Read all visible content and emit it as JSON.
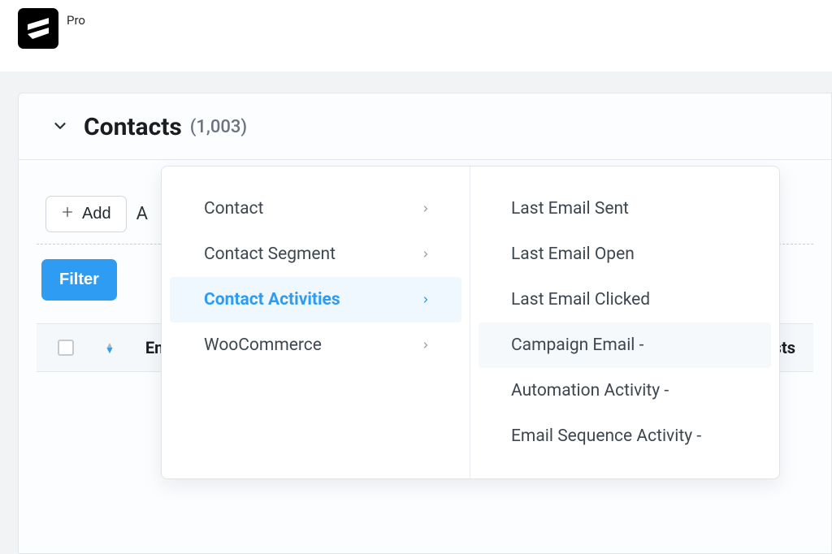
{
  "header": {
    "pro_label": "Pro"
  },
  "page": {
    "title": "Contacts",
    "count": "(1,003)"
  },
  "toolbar": {
    "add_label": "Add",
    "row_tail": "A"
  },
  "actions": {
    "filter_label": "Filter"
  },
  "table": {
    "col_left_fragment": "En",
    "col_right_fragment": "Lists"
  },
  "dropdown": {
    "categories": [
      {
        "label": "Contact",
        "selected": false
      },
      {
        "label": "Contact Segment",
        "selected": false
      },
      {
        "label": "Contact Activities",
        "selected": true
      },
      {
        "label": "WooCommerce",
        "selected": false
      }
    ],
    "options": [
      {
        "label": "Last Email Sent",
        "hovered": false
      },
      {
        "label": "Last Email Open",
        "hovered": false
      },
      {
        "label": "Last Email Clicked",
        "hovered": false
      },
      {
        "label": "Campaign Email -",
        "hovered": true
      },
      {
        "label": "Automation Activity -",
        "hovered": false
      },
      {
        "label": "Email Sequence Activity -",
        "hovered": false
      }
    ]
  }
}
